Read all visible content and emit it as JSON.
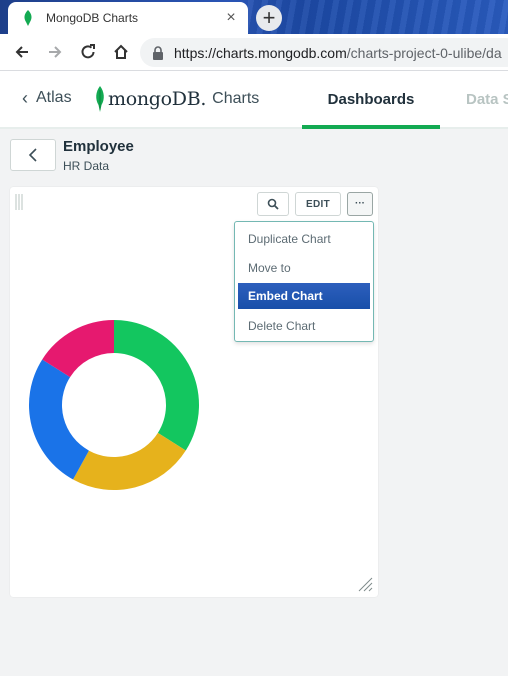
{
  "browser": {
    "tab_title": "MongoDB Charts",
    "tab_close": "×",
    "new_tab": "+",
    "url_host": "https://charts.mongodb.com",
    "url_path": "/charts-project-0-ulibe/da"
  },
  "header": {
    "back_label": "Atlas",
    "logo_word": "mongoDB.",
    "logo_suffix": "Charts",
    "tabs": [
      {
        "label": "Dashboards",
        "active": true
      },
      {
        "label": "Data S",
        "active": false
      }
    ],
    "accent_color": "#13aa52"
  },
  "dashboard": {
    "title": "Employee",
    "subtitle": "HR Data"
  },
  "chart_card": {
    "edit_label": "EDIT",
    "more_label": "···"
  },
  "menu": {
    "items": [
      {
        "label": "Duplicate Chart"
      },
      {
        "label": "Move to"
      },
      {
        "label": "Embed Chart",
        "highlighted": true
      },
      {
        "label": "Delete Chart"
      }
    ]
  },
  "chart_data": {
    "type": "pie",
    "variant": "donut",
    "segments": [
      {
        "color": "#13c65f",
        "value": 0.34
      },
      {
        "color": "#e6b21c",
        "value": 0.24
      },
      {
        "color": "#1a73e8",
        "value": 0.26
      },
      {
        "color": "#e6196f",
        "value": 0.16
      }
    ],
    "legend": "none"
  }
}
